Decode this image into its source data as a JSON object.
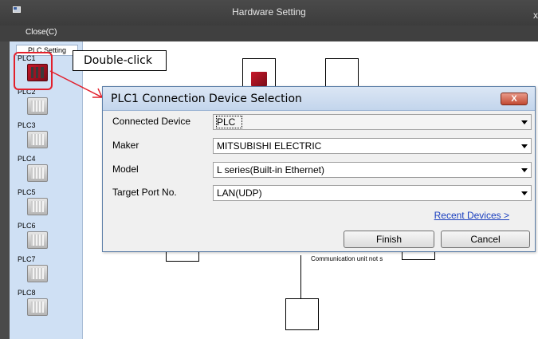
{
  "window": {
    "title": "Hardware Setting",
    "close_glyph": "x",
    "icon": "window-icon"
  },
  "menu": {
    "close_label": "Close(C)"
  },
  "plc_panel": {
    "header": "PLC Setting",
    "items": [
      {
        "label": "PLC1",
        "state": "configured"
      },
      {
        "label": "PLC2",
        "state": "empty"
      },
      {
        "label": "PLC3",
        "state": "empty"
      },
      {
        "label": "PLC4",
        "state": "empty"
      },
      {
        "label": "PLC5",
        "state": "empty"
      },
      {
        "label": "PLC6",
        "state": "empty"
      },
      {
        "label": "PLC7",
        "state": "empty"
      },
      {
        "label": "PLC8",
        "state": "empty"
      }
    ]
  },
  "annotation": {
    "callout_text": "Double-click",
    "highlight_color": "#e2202c"
  },
  "diagram": {
    "comm_note": "Communication unit not s"
  },
  "dialog": {
    "title": "PLC1 Connection Device Selection",
    "close_glyph": "X",
    "fields": [
      {
        "label": "Connected Device",
        "value": "PLC"
      },
      {
        "label": "Maker",
        "value": "MITSUBISHI ELECTRIC"
      },
      {
        "label": "Model",
        "value": "L series(Built-in Ethernet)"
      },
      {
        "label": "Target Port No.",
        "value": "LAN(UDP)"
      }
    ],
    "recent_link": "Recent Devices >",
    "finish_label": "Finish",
    "cancel_label": "Cancel"
  },
  "colors": {
    "titlebar": "#3c3c3c",
    "panel": "#cfe0f4",
    "dialog_title": "#c3d5ec",
    "close_button": "#c24a33",
    "link": "#1a3fbf"
  }
}
